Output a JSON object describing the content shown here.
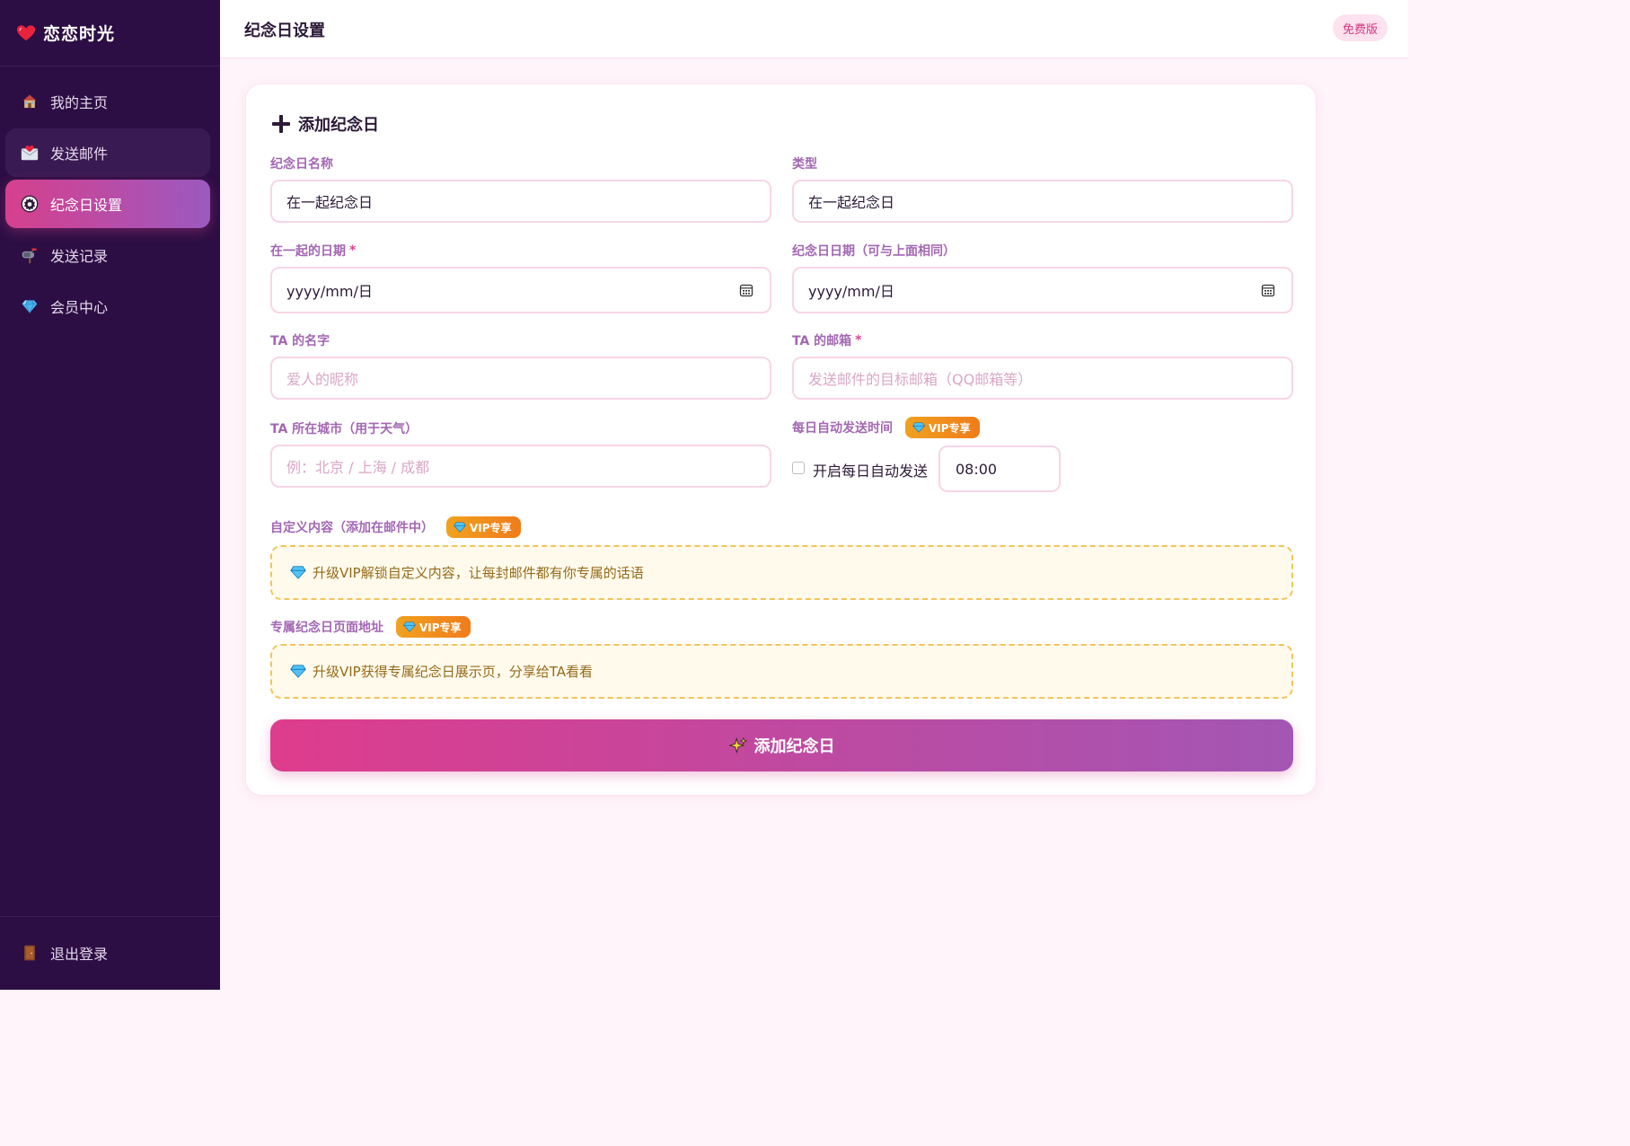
{
  "app": {
    "brand": "恋恋时光"
  },
  "sidebar": {
    "items": [
      {
        "label": "我的主页",
        "icon": "house-icon"
      },
      {
        "label": "发送邮件",
        "icon": "envelope-heart-icon"
      },
      {
        "label": "纪念日设置",
        "icon": "gear-icon"
      },
      {
        "label": "发送记录",
        "icon": "mailbox-icon"
      },
      {
        "label": "会员中心",
        "icon": "gem-icon"
      }
    ],
    "active_index": 2,
    "logout_label": "退出登录"
  },
  "header": {
    "title": "纪念日设置",
    "plan_badge": "免费版"
  },
  "form": {
    "card_title": "添加纪念日",
    "name_label": "纪念日名称",
    "name_value": "在一起纪念日",
    "type_label": "类型",
    "type_value": "在一起纪念日",
    "together_date_label": "在一起的日期",
    "together_date_required": "*",
    "together_date_value": "yyyy/mm/日",
    "anniv_date_label": "纪念日日期（可与上面相同）",
    "anniv_date_value": "yyyy/mm/日",
    "ta_name_label": "TA 的名字",
    "ta_name_placeholder": "爱人的昵称",
    "ta_email_label": "TA 的邮箱",
    "ta_email_required": "*",
    "ta_email_placeholder": "发送邮件的目标邮箱（QQ邮箱等）",
    "ta_city_label": "TA 所在城市（用于天气）",
    "ta_city_placeholder": "例：北京 / 上海 / 成都",
    "auto_send_label": "每日自动发送时间",
    "auto_send_checkbox_label": "开启每日自动发送",
    "auto_send_checked": false,
    "auto_send_time": "08:00",
    "vip_badge": "VIP专享",
    "custom_content_label": "自定义内容（添加在邮件中）",
    "custom_content_upsell": "升级VIP解锁自定义内容，让每封邮件都有你专属的话语",
    "page_url_label": "专属纪念日页面地址",
    "page_url_upsell": "升级VIP获得专属纪念日展示页，分享给TA看看",
    "submit_label": "添加纪念日"
  },
  "colors": {
    "sidebar_bg": "#2c0e44",
    "accent_pink": "#de3c8c",
    "accent_purple": "#a356b4",
    "label": "#a367b3",
    "vip_orange": "#f07b1a"
  }
}
